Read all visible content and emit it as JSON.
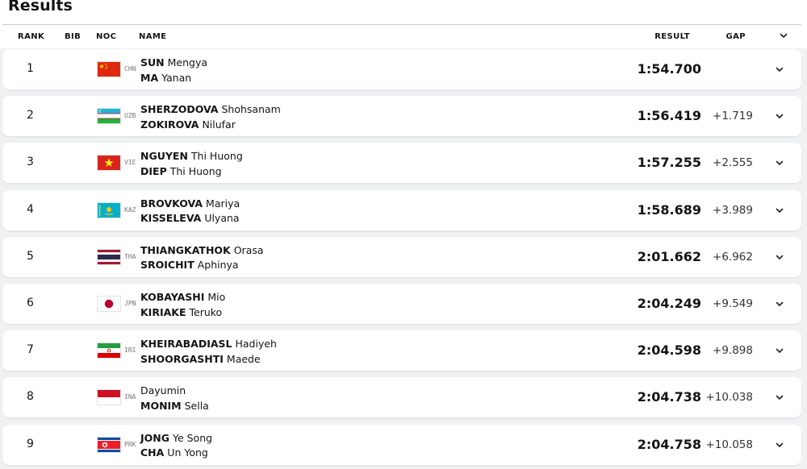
{
  "page_title": "Results",
  "columns": {
    "rank": "RANK",
    "bib": "BIB",
    "noc": "NOC",
    "name": "NAME",
    "result": "RESULT",
    "gap": "GAP"
  },
  "rows": [
    {
      "rank": "1",
      "noc": "CHN",
      "flag_icon": "china-flag-icon",
      "a1_last": "SUN",
      "a1_first": "Mengya",
      "a2_last": "MA",
      "a2_first": "Yanan",
      "result": "1:54.700",
      "gap": ""
    },
    {
      "rank": "2",
      "noc": "UZB",
      "flag_icon": "uzbekistan-flag-icon",
      "a1_last": "SHERZODOVA",
      "a1_first": "Shohsanam",
      "a2_last": "ZOKIROVA",
      "a2_first": "Nilufar",
      "result": "1:56.419",
      "gap": "+1.719"
    },
    {
      "rank": "3",
      "noc": "VIE",
      "flag_icon": "vietnam-flag-icon",
      "a1_last": "NGUYEN",
      "a1_first": "Thi Huong",
      "a2_last": "DIEP",
      "a2_first": "Thi Huong",
      "result": "1:57.255",
      "gap": "+2.555"
    },
    {
      "rank": "4",
      "noc": "KAZ",
      "flag_icon": "kazakhstan-flag-icon",
      "a1_last": "BROVKOVA",
      "a1_first": "Mariya",
      "a2_last": "KISSELEVA",
      "a2_first": "Ulyana",
      "result": "1:58.689",
      "gap": "+3.989"
    },
    {
      "rank": "5",
      "noc": "THA",
      "flag_icon": "thailand-flag-icon",
      "a1_last": "THIANGKATHOK",
      "a1_first": "Orasa",
      "a2_last": "SROICHIT",
      "a2_first": "Aphinya",
      "result": "2:01.662",
      "gap": "+6.962"
    },
    {
      "rank": "6",
      "noc": "JPN",
      "flag_icon": "japan-flag-icon",
      "a1_last": "KOBAYASHI",
      "a1_first": "Mio",
      "a2_last": "KIRIAKE",
      "a2_first": "Teruko",
      "result": "2:04.249",
      "gap": "+9.549"
    },
    {
      "rank": "7",
      "noc": "IRI",
      "flag_icon": "iran-flag-icon",
      "a1_last": "KHEIRABADIASL",
      "a1_first": "Hadiyeh",
      "a2_last": "SHOORGASHTI",
      "a2_first": "Maede",
      "result": "2:04.598",
      "gap": "+9.898"
    },
    {
      "rank": "8",
      "noc": "INA",
      "flag_icon": "indonesia-flag-icon",
      "a1_last": "",
      "a1_first": "Dayumin",
      "a2_last": "MONIM",
      "a2_first": "Sella",
      "result": "2:04.738",
      "gap": "+10.038"
    },
    {
      "rank": "9",
      "noc": "PRK",
      "flag_icon": "north-korea-flag-icon",
      "a1_last": "JONG",
      "a1_first": "Ye Song",
      "a2_last": "CHA",
      "a2_first": "Un Yong",
      "result": "2:04.758",
      "gap": "+10.058"
    }
  ]
}
